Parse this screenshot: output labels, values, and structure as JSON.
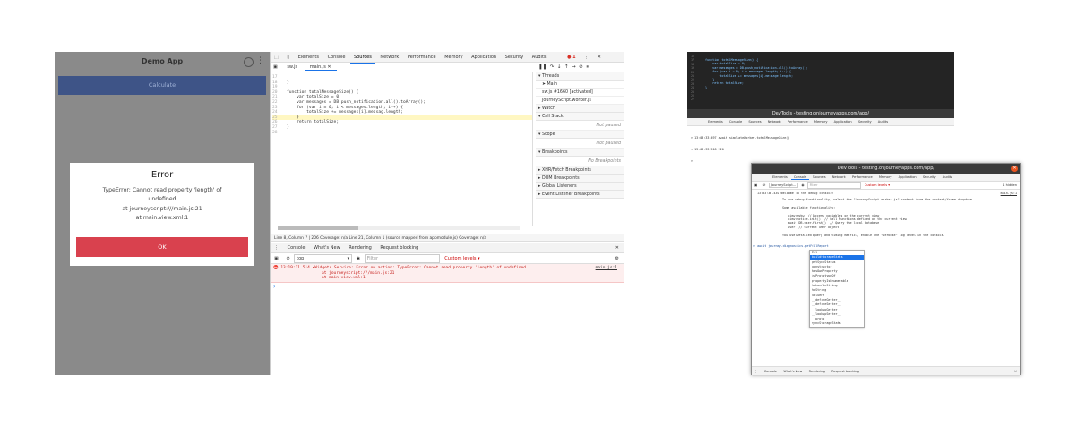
{
  "app": {
    "title": "Demo App",
    "calculate_label": "Calculate",
    "dialog": {
      "title": "Error",
      "message_lines": [
        "TypeError: Cannot read property 'length' of",
        "undefined",
        "at journeyscript:///main.js:21",
        "at main.view.xml:1"
      ],
      "ok_label": "OK"
    }
  },
  "devtools": {
    "tabs": [
      "Elements",
      "Console",
      "Sources",
      "Network",
      "Performance",
      "Memory",
      "Application",
      "Security",
      "Audits"
    ],
    "active_tab": "Sources",
    "error_badge": "1",
    "files": [
      "sw.js",
      "main.js"
    ],
    "code_lines": [
      {
        "n": "17",
        "t": ""
      },
      {
        "n": "18",
        "t": "}"
      },
      {
        "n": "19",
        "t": ""
      },
      {
        "n": "20",
        "t": "function totalMessageSize() {"
      },
      {
        "n": "21",
        "t": "    var totalSize = 0;"
      },
      {
        "n": "22",
        "t": "    var messages = DB.push_notification.all().toArray();"
      },
      {
        "n": "23",
        "t": "    for (var i = 0; i < messages.length; i++) {"
      },
      {
        "n": "24",
        "t": "        totalSize += messages[i].messag.length;"
      },
      {
        "n": "25",
        "t": "    }"
      },
      {
        "n": "26",
        "t": "    return totalSize;"
      },
      {
        "n": "27",
        "t": "}"
      },
      {
        "n": "28",
        "t": ""
      }
    ],
    "status_bar": "Line 8, Column 7 | 206   Coverage: n/a   Line 21, Column 1   (source mapped from appmodule.js)   Coverage: n/a",
    "threads_label": "Threads",
    "threads": [
      "Main",
      "sw.js #1660 [activated]",
      "JourneyScript.worker.js"
    ],
    "watch_label": "Watch",
    "call_stack_label": "Call Stack",
    "not_paused": "Not paused",
    "scope_label": "Scope",
    "breakpoints_label": "Breakpoints",
    "no_breakpoints": "No Breakpoints",
    "other_sections": [
      "XHR/Fetch Breakpoints",
      "DOM Breakpoints",
      "Global Listeners",
      "Event Listener Breakpoints"
    ],
    "drawer_tabs": [
      "Console",
      "What's New",
      "Rendering",
      "Request blocking"
    ],
    "context": "top",
    "filter_placeholder": "Filter",
    "levels": "Custom levels ▾",
    "console_error": "13:19:11.514 ▸Widgets Service: Error on action: TypeError: Cannot read property 'length' of undefined",
    "console_error_2": "at journeyscript:///main.js:21",
    "console_error_3": "at main.view.xml:1",
    "console_error_src": "main.js:1"
  },
  "right_top": {
    "code": "function totalMessageSize() {\n    var totalSize = 0;\n    var messages = DB.push_notification.all().toArray();\n    for (var i = 0; i < messages.length; i++) {\n        totalSize += messages[i].message.length;\n    }\n    return totalSize;\n}",
    "title": "DevTools - testing.onjourneyapps.com/app/",
    "tabs": [
      "Elements",
      "Console",
      "Sources",
      "Network",
      "Performance",
      "Memory",
      "Application",
      "Security",
      "Audits"
    ],
    "console_lines": [
      "> 13:03:33.497 await simulateWorker.totalMessageSize()",
      "< 13:03:33.518 220",
      ">"
    ]
  },
  "right_bottom": {
    "title": "DevTools - testing.onjourneyapps.com/app/",
    "tabs": [
      "Elements",
      "Console",
      "Sources",
      "Network",
      "Performance",
      "Memory",
      "Application",
      "Security",
      "Audits"
    ],
    "context": "JourneyScript...",
    "filter_placeholder": "Filter",
    "levels": "Custom levels ▾",
    "hidden": "1 hidden",
    "welcome": "13:03:33.430 Welcome to the debug console!",
    "welcome_src": "main.js:1",
    "body": "To use debug functionality, select the \"JourneyScript.worker.js\" context from the context/frame dropdown.\n\nSome available functionality:\n\n   view.mykw  // Access variables on the current view\n   view.notice.init()  // Call functions defined on the current view\n   await DB.user.first()  // Query the local database\n   user  // Current user object\n\nYou use Detailed query and timing metrics, enable the \"Verbose\" log level in the console.",
    "prompt": "> await journey.diagnostics.getFullReport",
    "autocomplete": [
      "all",
      "buildStorageStats",
      "getSyncStatus",
      "constructor",
      "hasOwnProperty",
      "isPrototypeOf",
      "propertyIsEnumerable",
      "toLocaleString",
      "toString",
      "valueOf",
      "__defineGetter__",
      "__defineSetter__",
      "__lookupGetter__",
      "__lookupSetter__",
      "__proto__",
      "syncStorageStats"
    ],
    "drawer_tabs": [
      "Console",
      "What's New",
      "Rendering",
      "Request blocking"
    ]
  }
}
